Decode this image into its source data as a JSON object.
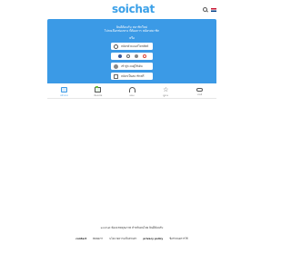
{
  "header": {
    "logo_text": "soichat",
    "search_icon": "search-icon",
    "language_icon": "uk-flag-icon"
  },
  "card": {
    "welcome_line1": "ยินดีต้อนรับ สมาชิกใหม่",
    "welcome_line2": "โปรดเลือกช่องทาง ที่ต้องการ สมัครสมาชิก",
    "or_text": "หรือ",
    "phone_button": "สมัครด้วยเบอร์โทรศัพท์",
    "social_icons": [
      "facebook-icon",
      "google-icon",
      "twitter-icon",
      "google-plus-icon"
    ],
    "member_button": "เข้าสู่ระบบผู้ใช้เดิม",
    "guest_button": "สมัครเป็นสมาชิกฟรี",
    "accent_color": "#3b9ae6"
  },
  "nav": {
    "items": [
      {
        "label": "หน้าแรก",
        "icon": "home-icon"
      },
      {
        "label": "ห้องแชท",
        "icon": "folder-icon"
      },
      {
        "label": "เพลง",
        "icon": "headset-icon"
      },
      {
        "label": "ดูดวง",
        "icon": "star-icon"
      },
      {
        "label": "เกมส์",
        "icon": "gamepad-icon"
      }
    ]
  },
  "footer": {
    "copyright": "soichat ห้องแชทคุณภาพ สำหรับคนไทย ยินดีต้อนรับ",
    "links": [
      "contact",
      "ติดต่อเรา",
      "นโยบายความเป็นส่วนตัว",
      "privacy policy",
      "ข้อกำหนดการใช้"
    ]
  }
}
